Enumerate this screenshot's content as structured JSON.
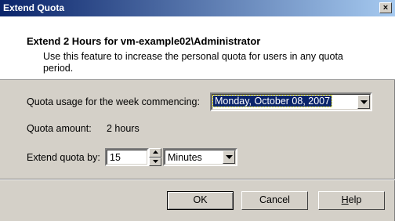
{
  "window": {
    "title": "Extend Quota",
    "close_label": "×"
  },
  "header": {
    "title": "Extend 2 Hours for vm-example02\\Administrator",
    "description": "Use this feature to increase the personal quota for users in any quota period."
  },
  "week": {
    "label": "Quota usage for the week commencing:",
    "selected": "Monday, October 08, 2007"
  },
  "amount": {
    "label": "Quota amount:",
    "value": "2 hours"
  },
  "extend": {
    "label": "Extend quota by:",
    "value": "15",
    "unit_selected": "Minutes"
  },
  "buttons": {
    "ok": "OK",
    "cancel": "Cancel",
    "help_mnemonic": "H",
    "help_rest": "elp"
  },
  "colors": {
    "titlebar_start": "#0a246a",
    "titlebar_end": "#a6caf0",
    "dialog_bg": "#d4d0c8",
    "selection": "#0a246a"
  }
}
